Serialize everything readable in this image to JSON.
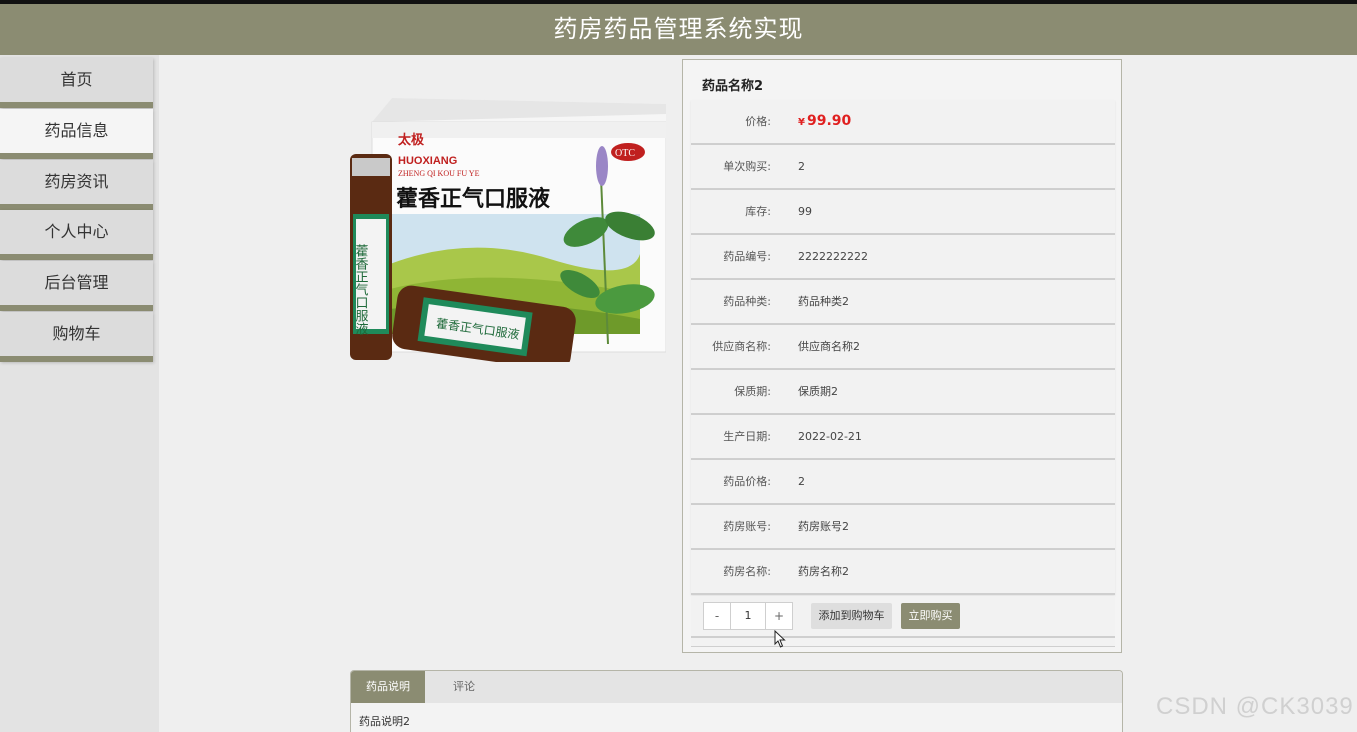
{
  "header": {
    "title": "药房药品管理系统实现"
  },
  "sidebar": {
    "items": [
      {
        "label": "首页"
      },
      {
        "label": "药品信息"
      },
      {
        "label": "药房资讯"
      },
      {
        "label": "个人中心"
      },
      {
        "label": "后台管理"
      },
      {
        "label": "购物车"
      }
    ]
  },
  "product": {
    "name": "药品名称2",
    "image": {
      "brand": "太极",
      "pinyin_brand": "HUOXIANG",
      "pinyin_name": "ZHENG QI KOU FU YE",
      "title": "藿香正气口服液",
      "otc": "OTC",
      "vial_text": "藿香正气口服液"
    },
    "price": {
      "label": "价格:",
      "currency": "¥",
      "value": "99.90"
    },
    "fields": [
      {
        "label": "单次购买:",
        "value": "2"
      },
      {
        "label": "库存:",
        "value": "99"
      },
      {
        "label": "药品编号:",
        "value": "2222222222"
      },
      {
        "label": "药品种类:",
        "value": "药品种类2"
      },
      {
        "label": "供应商名称:",
        "value": "供应商名称2"
      },
      {
        "label": "保质期:",
        "value": "保质期2"
      },
      {
        "label": "生产日期:",
        "value": "2022-02-21"
      },
      {
        "label": "药品价格:",
        "value": "2"
      },
      {
        "label": "药房账号:",
        "value": "药房账号2"
      },
      {
        "label": "药房名称:",
        "value": "药房名称2"
      }
    ],
    "quantity": {
      "minus": "-",
      "value": "1",
      "plus": "+"
    },
    "add_to_cart": "添加到购物车",
    "buy_now": "立即购买"
  },
  "tabs": {
    "items": [
      {
        "label": "药品说明"
      },
      {
        "label": "评论"
      }
    ],
    "content": "药品说明2"
  },
  "watermark": "CSDN @CK3039",
  "colors": {
    "accent": "#8b8c72",
    "price": "#e02020"
  }
}
